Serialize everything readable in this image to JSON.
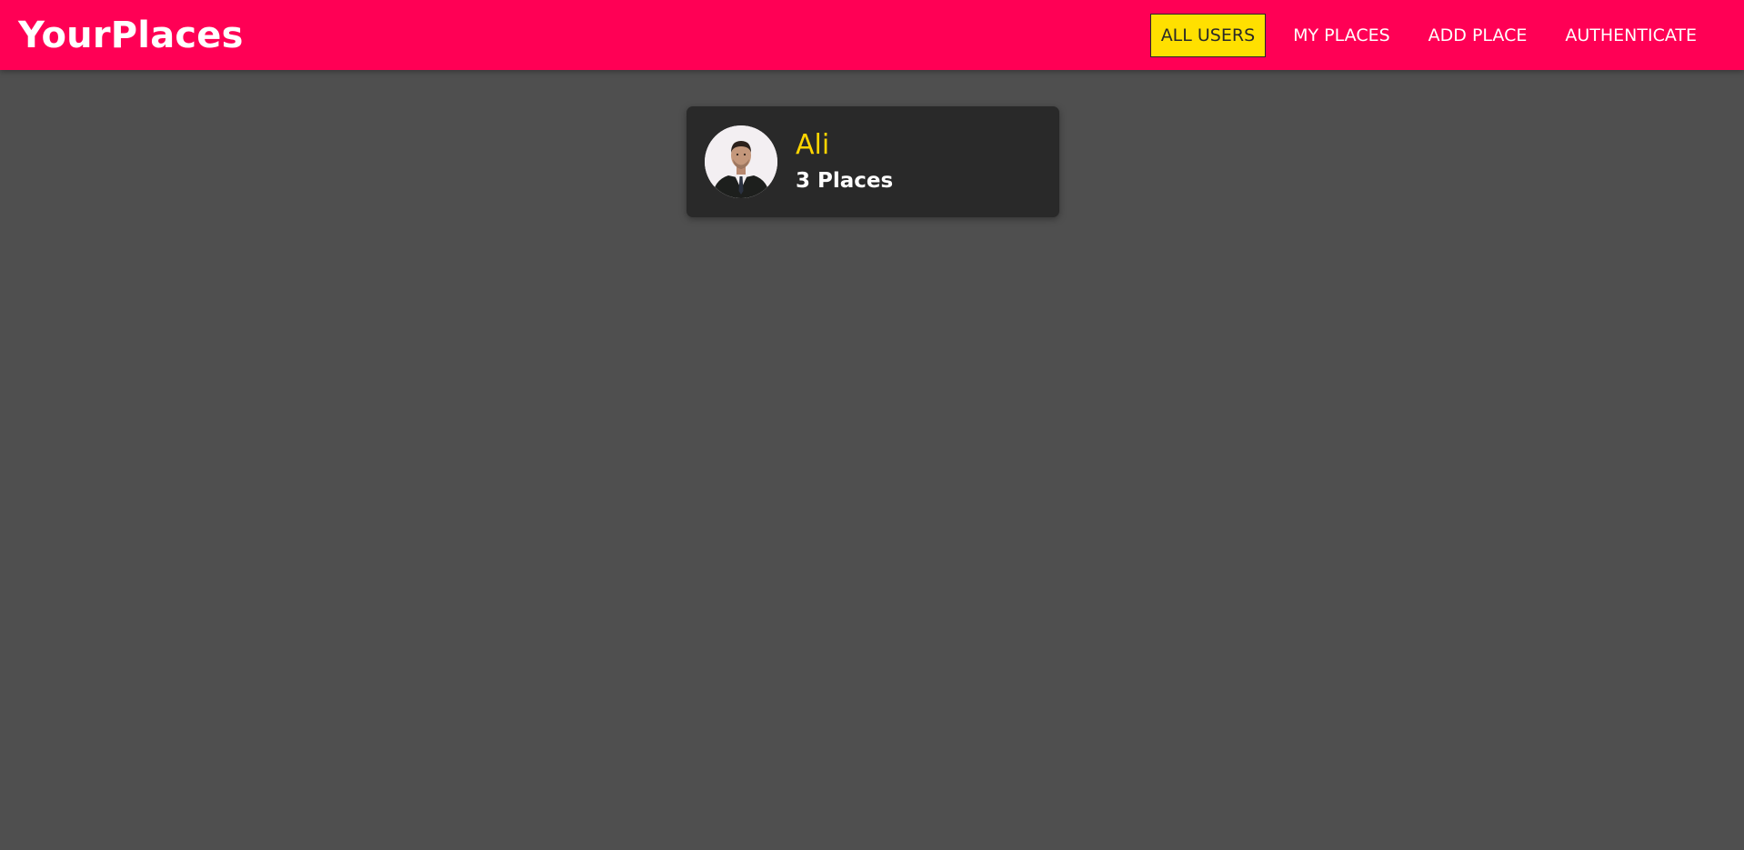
{
  "app": {
    "brand": "YourPlaces"
  },
  "nav": {
    "items": [
      {
        "label": "ALL USERS",
        "active": true
      },
      {
        "label": "MY PLACES",
        "active": false
      },
      {
        "label": "ADD PLACE",
        "active": false
      },
      {
        "label": "AUTHENTICATE",
        "active": false
      }
    ]
  },
  "users": [
    {
      "name": "Ali",
      "places_label": "3 Places",
      "avatar_icon": "user-portrait"
    }
  ],
  "colors": {
    "header_bg": "#ff0055",
    "page_bg": "#4f4f4f",
    "card_bg": "#292929",
    "active_nav_bg": "#ffe000",
    "user_name": "#ffd500",
    "text_light": "#ffffff"
  }
}
